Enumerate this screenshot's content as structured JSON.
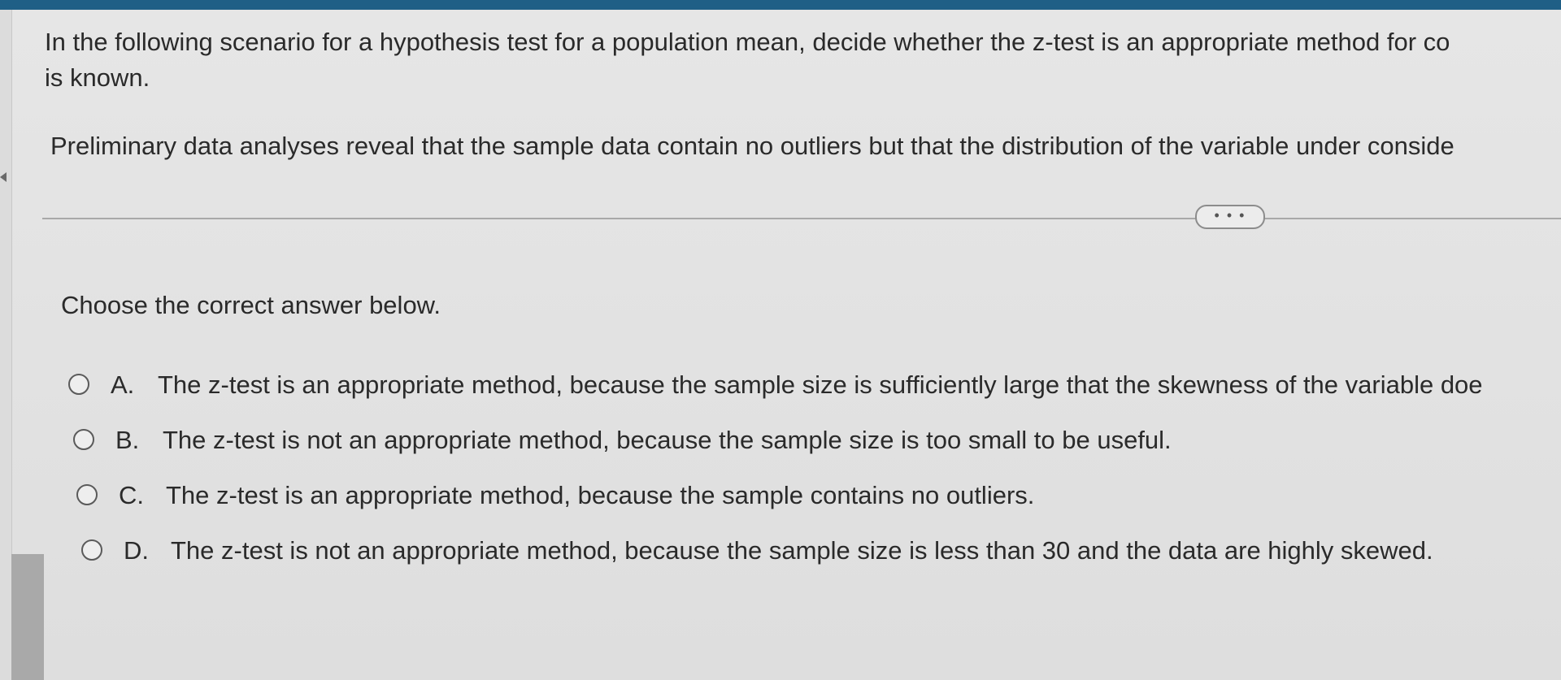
{
  "question": {
    "text": "In the following scenario for a hypothesis test for a population mean, decide whether the z-test is an appropriate method for co",
    "text_line2": "is known."
  },
  "scenario": {
    "text": "Preliminary data analyses reveal that the sample data contain no outliers but that the distribution of the variable under conside"
  },
  "more_button": {
    "label": "• • •"
  },
  "prompt": {
    "text": "Choose the correct answer below."
  },
  "options": [
    {
      "letter": "A.",
      "text": "The z-test is an appropriate method, because the sample size is sufficiently large that the skewness of the variable doe",
      "selected": false
    },
    {
      "letter": "B.",
      "text": "The z-test is not an appropriate method, because the sample size is too small to be useful.",
      "selected": false
    },
    {
      "letter": "C.",
      "text": "The z-test is an appropriate method, because the sample contains no outliers.",
      "selected": false
    },
    {
      "letter": "D.",
      "text": "The z-test is not an appropriate method, because the sample size is less than 30 and the data are highly skewed.",
      "selected": false
    }
  ],
  "colors": {
    "top_bar": "#1f5f86",
    "background": "#e4e4e4",
    "text": "#2a2a2a"
  }
}
